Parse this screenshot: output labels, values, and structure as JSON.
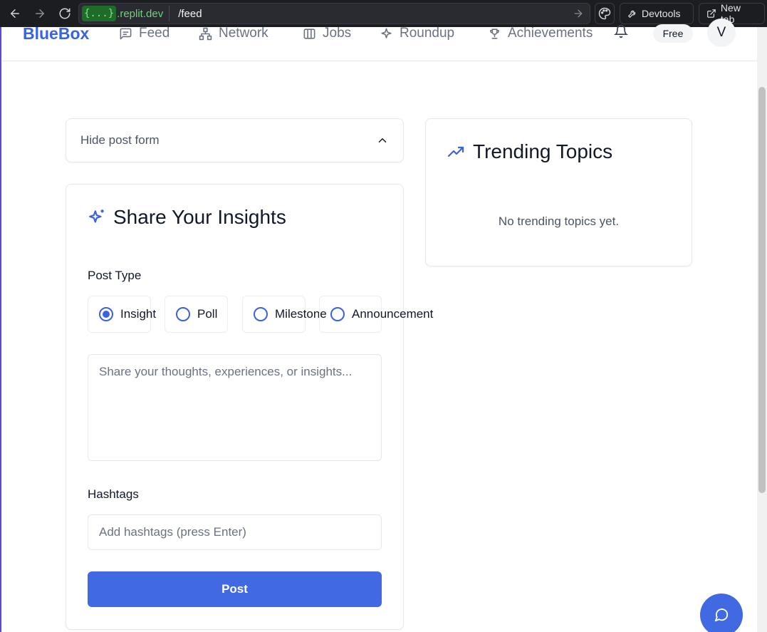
{
  "browser": {
    "url_badge": "{...}",
    "url_domain": ".replit.dev",
    "url_path": "/feed",
    "devtools_label": "Devtools",
    "new_tab_label": "New tab"
  },
  "header": {
    "logo": "BlueBox",
    "nav": [
      {
        "label": "Feed",
        "icon": "message-square-icon"
      },
      {
        "label": "Network",
        "icon": "network-icon"
      },
      {
        "label": "Jobs",
        "icon": "columns-icon"
      },
      {
        "label": "Roundup",
        "icon": "sparkles-icon"
      },
      {
        "label": "Achievements",
        "icon": "trophy-icon"
      }
    ],
    "plan_badge": "Free",
    "avatar_initial": "V"
  },
  "post_form_toggle": {
    "label": "Hide post form"
  },
  "post_form": {
    "title": "Share Your Insights",
    "post_type_label": "Post Type",
    "post_types": [
      {
        "label": "Insight",
        "checked": true
      },
      {
        "label": "Poll",
        "checked": false
      },
      {
        "label": "Milestone",
        "checked": false
      },
      {
        "label": "Announcement",
        "checked": false
      }
    ],
    "content_placeholder": "Share your thoughts, experiences, or insights...",
    "hashtags_label": "Hashtags",
    "hashtags_placeholder": "Add hashtags (press Enter)",
    "submit_label": "Post"
  },
  "trending": {
    "title": "Trending Topics",
    "empty_text": "No trending topics yet."
  },
  "colors": {
    "accent": "#3b62e0",
    "button": "#4169e1"
  }
}
